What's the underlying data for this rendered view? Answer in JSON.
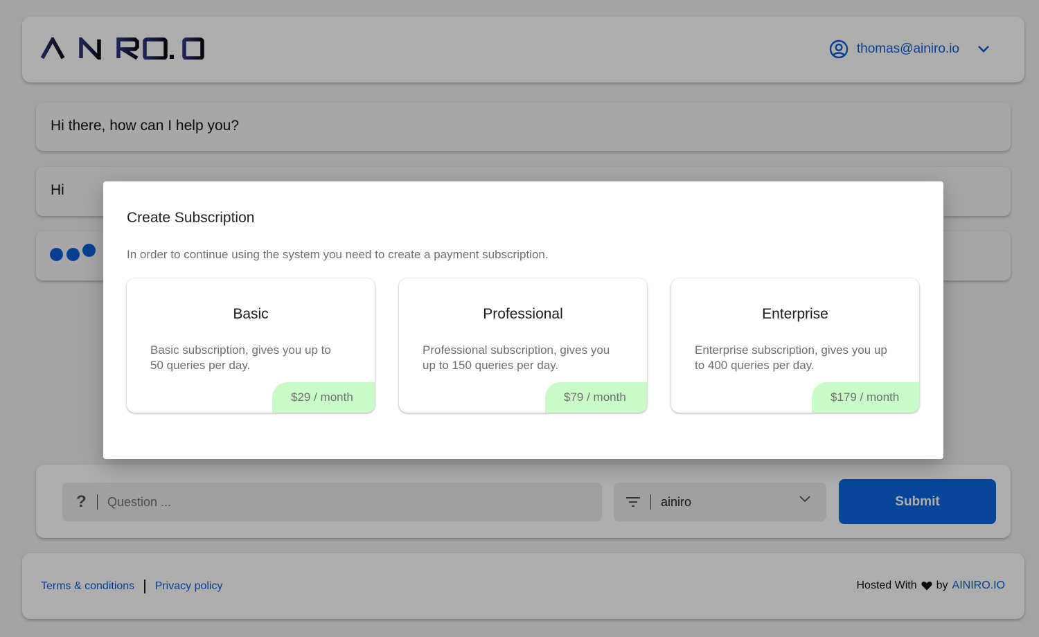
{
  "header": {
    "logo_text": "AINIRO.IO",
    "user_email": "thomas@ainiro.io",
    "colors": {
      "accent": "#0a5fd8",
      "logo_left": "#2a2f7a",
      "logo_right": "#0b0b1c"
    }
  },
  "messages": [
    {
      "role": "assistant",
      "text": "Hi there, how can I help you?"
    },
    {
      "role": "user",
      "text": "Hi"
    },
    {
      "role": "assistant",
      "text": "",
      "status": "typing"
    }
  ],
  "input_bar": {
    "question_icon": "?",
    "question_placeholder": "Question ...",
    "question_value": "",
    "filter_icon": "filter-icon",
    "filter_value": "ainiro",
    "submit_label": "Submit"
  },
  "footer": {
    "terms_label": "Terms & conditions",
    "privacy_label": "Privacy policy",
    "hosted_with": "Hosted With",
    "by": "by",
    "brand_link": "AINIRO.IO"
  },
  "modal": {
    "title": "Create Subscription",
    "description": "In order to continue using the system you need to create a payment subscription.",
    "plans": [
      {
        "name": "Basic",
        "description": "Basic subscription, gives you up to 50 queries per day.",
        "price": "$29 / month"
      },
      {
        "name": "Professional",
        "description": "Professional subscription, gives you up to 150 queries per day.",
        "price": "$79 / month"
      },
      {
        "name": "Enterprise",
        "description": "Enterprise subscription, gives you up to 400 queries per day.",
        "price": "$179 / month"
      }
    ],
    "colors": {
      "price_badge": "#c9fbc9"
    }
  }
}
